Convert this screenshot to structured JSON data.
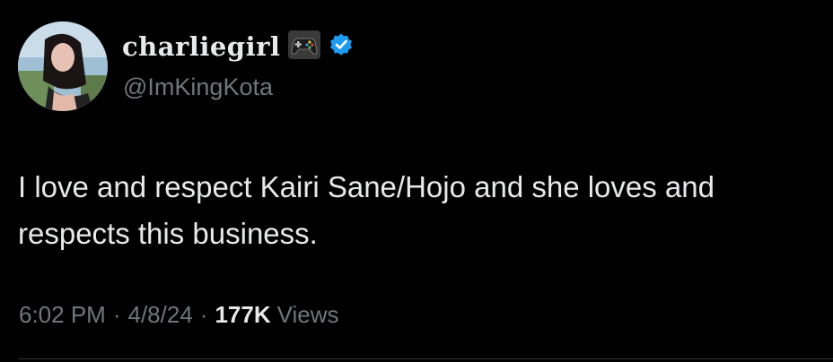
{
  "tweet": {
    "display_name": "charliegirl",
    "name_emoji_icon": "game-controller-icon",
    "verified_icon": "verified-badge-icon",
    "verified_color": "#1d9bf0",
    "handle": "@ImKingKota",
    "text": "I love and respect Kairi Sane/Hojo and she loves and respects this business.",
    "time": "6:02 PM",
    "separator": "·",
    "date": "4/8/24",
    "views_count": "177K",
    "views_label": "Views"
  },
  "colors": {
    "background": "#000000",
    "primary_text": "#e7e9ea",
    "secondary_text": "#71767b"
  }
}
